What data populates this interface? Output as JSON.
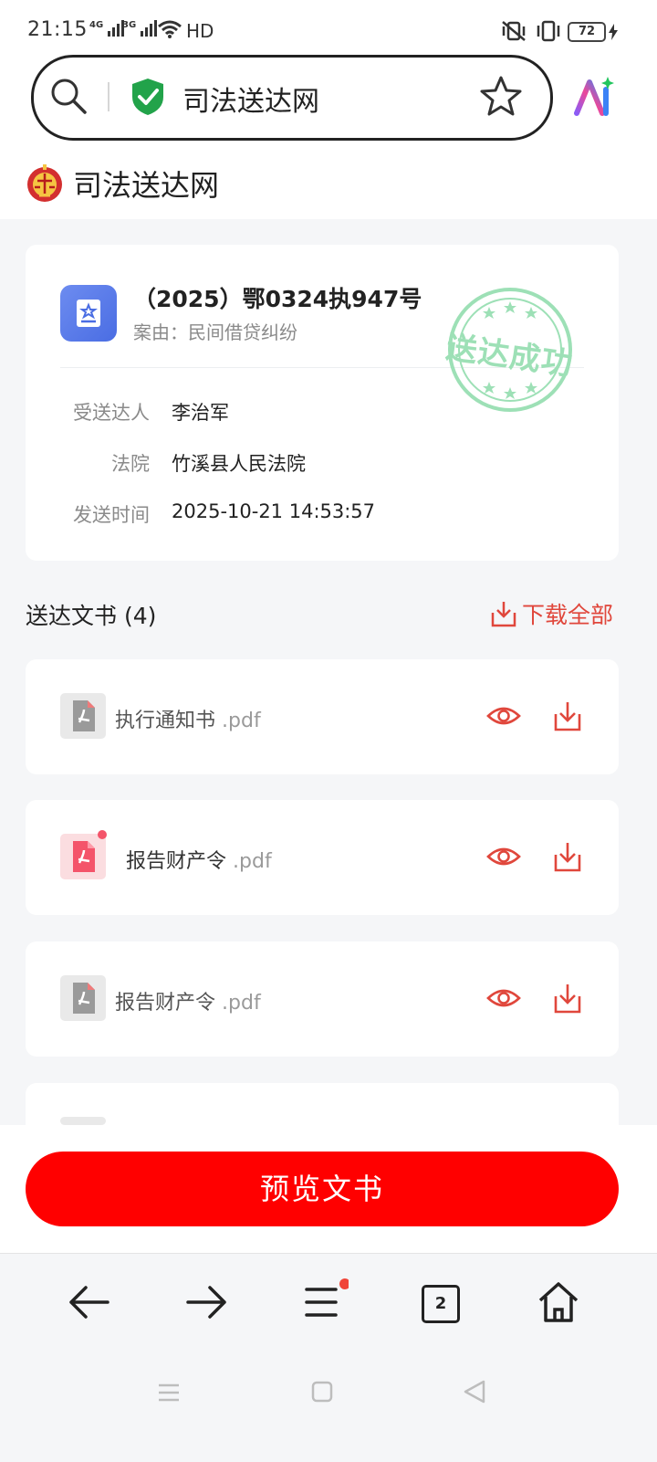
{
  "status_bar": {
    "time": "21:15",
    "net1": "4G",
    "net2": "3G",
    "hd": "HD",
    "battery": "72"
  },
  "address_bar": {
    "url_text": "司法送达网",
    "secure_color": "#22a34a"
  },
  "site": {
    "title": "司法送达网"
  },
  "case": {
    "number": "（2025）鄂0324执947号",
    "reason": "案由：民间借贷纠纷",
    "stamp_text": "送达成功",
    "fields": [
      {
        "label": "受送达人",
        "value": "李治军"
      },
      {
        "label": "法院",
        "value": "竹溪县人民法院"
      },
      {
        "label": "发送时间",
        "value": "2025-10-21 14:53:57"
      }
    ]
  },
  "documents": {
    "section_title": "送达文书 (4)",
    "download_all": "下载全部",
    "files": [
      {
        "name": "执行通知书",
        "ext": ".pdf",
        "highlighted": false
      },
      {
        "name": "报告财产令",
        "ext": ".pdf",
        "highlighted": true
      },
      {
        "name": "报告财产令",
        "ext": ".pdf",
        "highlighted": false
      }
    ]
  },
  "actions": {
    "preview_label": "预览文书"
  },
  "browser_nav": {
    "tab_count": "2"
  },
  "colors": {
    "accent_red": "#ff0000",
    "link_red": "#e0473c",
    "stamp_green": "#9de0b6"
  }
}
